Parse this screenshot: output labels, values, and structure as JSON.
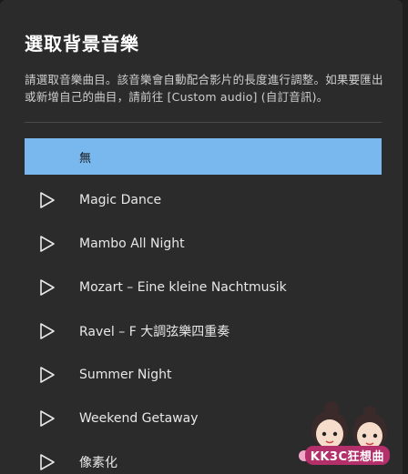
{
  "dialog": {
    "title": "選取背景音樂",
    "description": "請選取音樂曲目。該音樂會自動配合影片的長度進行調整。如果要匯出或新增自己的曲目，請前往 [Custom audio] (自訂音訊)。"
  },
  "tracks": [
    {
      "label": "無",
      "selected": true,
      "icon": "none"
    },
    {
      "label": "Magic Dance",
      "selected": false,
      "icon": "play-icon"
    },
    {
      "label": "Mambo All Night",
      "selected": false,
      "icon": "play-icon"
    },
    {
      "label": "Mozart – Eine kleine Nachtmusik",
      "selected": false,
      "icon": "play-icon"
    },
    {
      "label": "Ravel – F 大調弦樂四重奏",
      "selected": false,
      "icon": "play-icon"
    },
    {
      "label": "Summer Night",
      "selected": false,
      "icon": "play-icon"
    },
    {
      "label": "Weekend Getaway",
      "selected": false,
      "icon": "play-icon"
    },
    {
      "label": "像素化",
      "selected": false,
      "icon": "play-icon"
    }
  ],
  "watermark": {
    "text": "KK3C狂想曲"
  },
  "colors": {
    "selected_bg": "#79b8ee",
    "dialog_bg": "#2b2b2b",
    "text": "#e8e8e8"
  }
}
